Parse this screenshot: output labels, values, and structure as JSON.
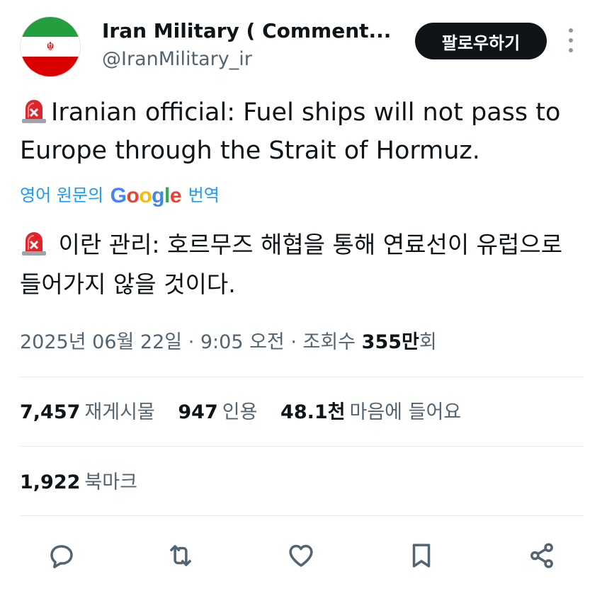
{
  "author": {
    "name": "Iran Military ( Comment...",
    "handle": "@IranMilitary_ir",
    "avatar_icon": "iran-flag-avatar"
  },
  "follow_button": {
    "label": "팔로우하기"
  },
  "tweet": {
    "siren_icon": "rotating-light-emoji",
    "text_en": "Iranian official: Fuel ships will not pass to Europe through the Strait of Hormuz.",
    "translate_prefix": "영어 원문의",
    "translate_brand": "Google",
    "translate_suffix": "번역",
    "text_ko": "이란 관리: 호르무즈 해협을 통해 연료선이 유럽으로 들어가지 않을 것이다."
  },
  "meta": {
    "date": "2025년 06월 22일",
    "time": "9:05 오전",
    "views_label": "조회수",
    "views_value": "355만",
    "views_suffix": "회"
  },
  "stats": {
    "reposts_value": "7,457",
    "reposts_label": "재게시물",
    "quotes_value": "947",
    "quotes_label": "인용",
    "likes_value": "48.1천",
    "likes_label": "마음에 들어요",
    "bookmarks_value": "1,922",
    "bookmarks_label": "북마크"
  },
  "colors": {
    "accent": "#1d9bf0",
    "text": "#0f1419",
    "secondary": "#536471",
    "button_bg": "#0f1419"
  }
}
